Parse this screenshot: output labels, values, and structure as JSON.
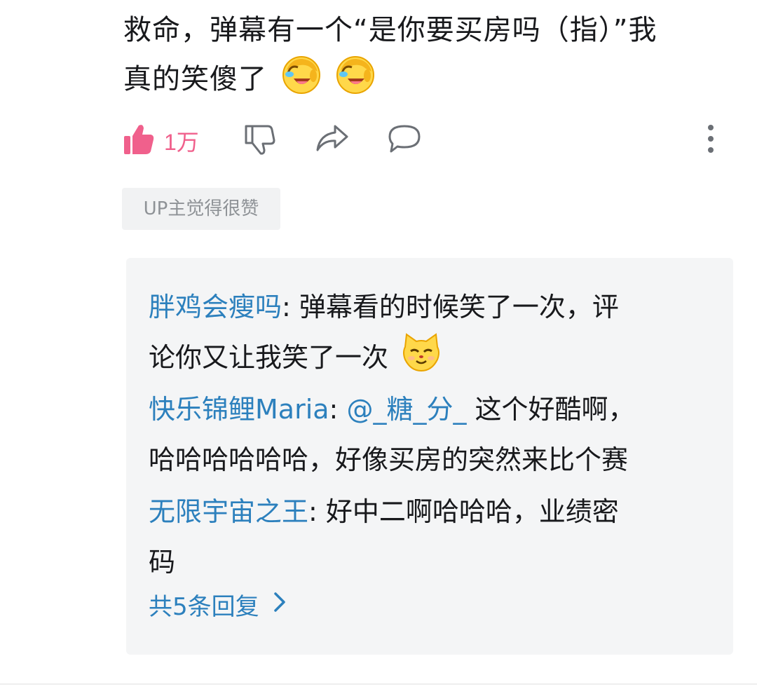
{
  "comment": {
    "text_line1": "救命，弹幕有一个“是你要买房吗（指）”我",
    "text_line2": "真的笑傻了",
    "emojis": [
      "laugh-cry-emoji",
      "laugh-cry-emoji"
    ]
  },
  "actions": {
    "like_count": "1万",
    "icons": [
      "thumbs-up-icon",
      "thumbs-down-icon",
      "share-icon",
      "reply-icon",
      "more-vertical-icon"
    ]
  },
  "up_badge": "UP主觉得很赞",
  "replies": [
    {
      "name": "胖鸡会瘦吗",
      "sep": ": ",
      "text_a": "弹幕看的时候笑了一次，评",
      "text_b": "论你又让我笑了一次",
      "emoji": "smug-cat-emoji"
    },
    {
      "name": "快乐锦鲤Maria",
      "sep": ": ",
      "mention": "@_糖_分_",
      "text_a": " 这个好酷啊，",
      "text_b": "哈哈哈哈哈哈，好像买房的突然来比个赛"
    },
    {
      "name": "无限宇宙之王",
      "sep": ": ",
      "text_a": "好中二啊哈哈哈，业绩密",
      "text_b": "码"
    }
  ],
  "more_replies": "共5条回复",
  "colors": {
    "accent_pink": "#f0608c",
    "link_blue": "#2c80bd",
    "text": "#18191c",
    "muted": "#8e9296",
    "reply_bg": "#f4f5f6"
  }
}
